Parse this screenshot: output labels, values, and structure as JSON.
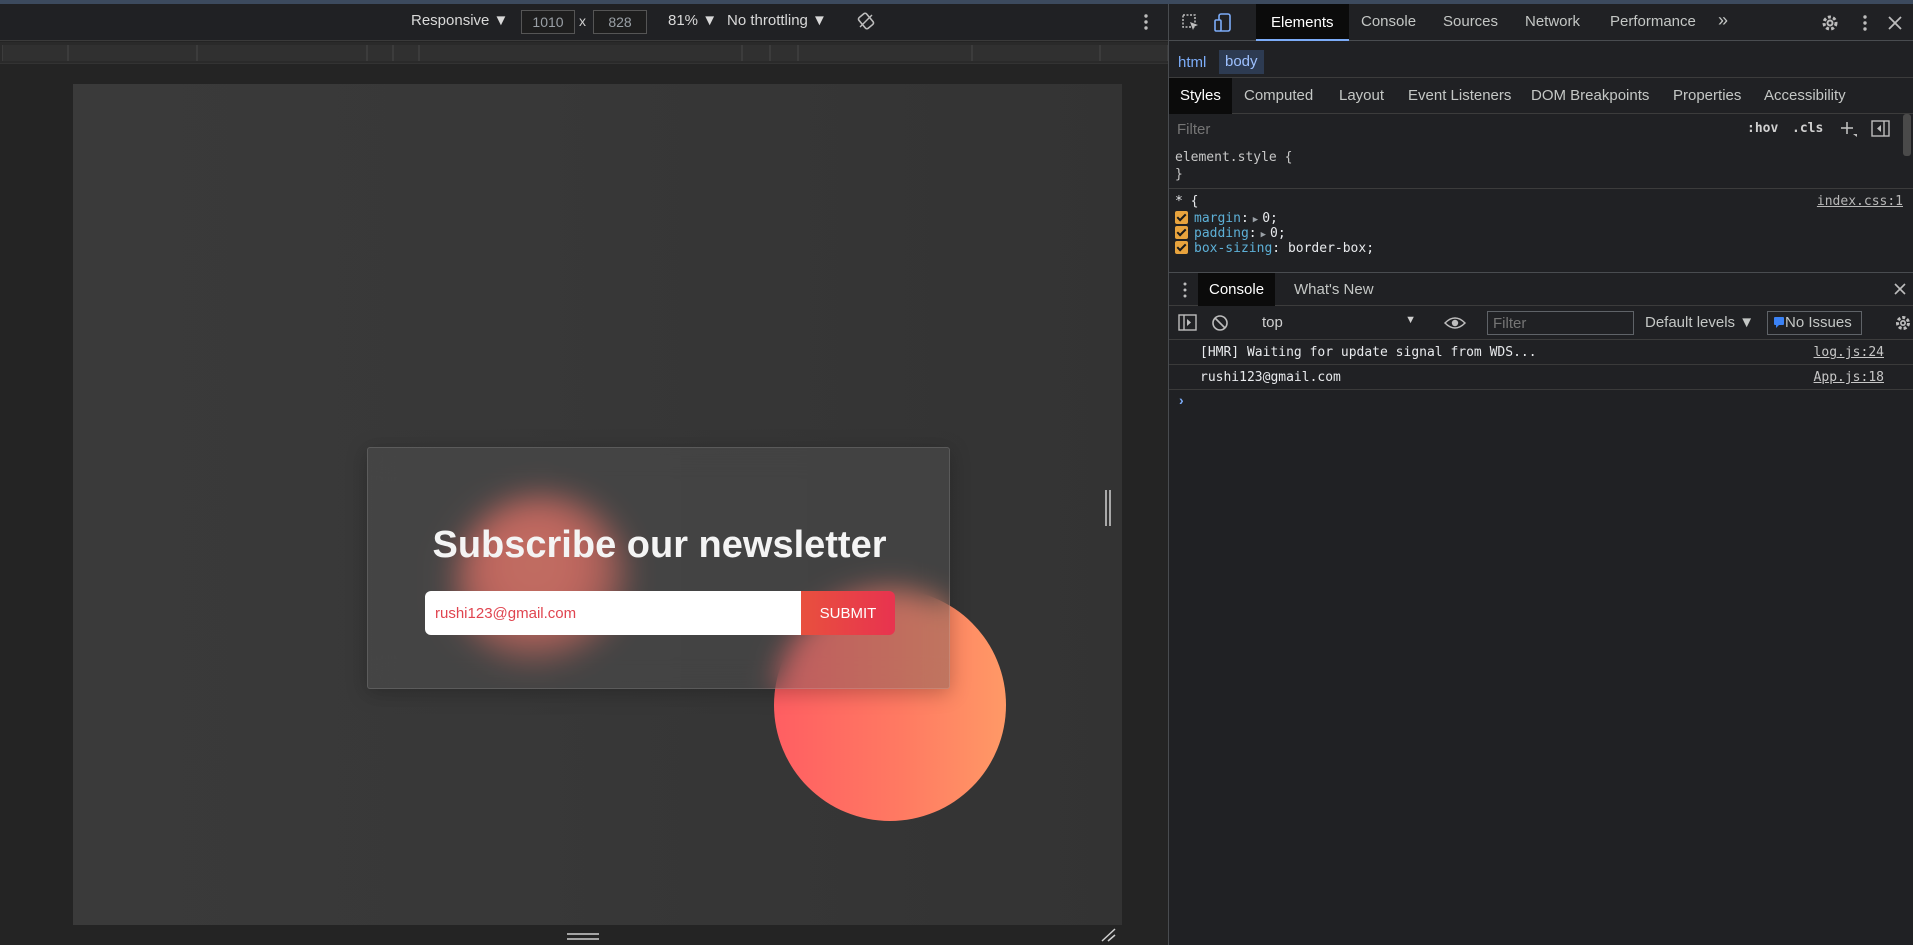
{
  "device_toolbar": {
    "device": "Responsive ▼",
    "width": "1010",
    "height": "828",
    "times": "x",
    "zoom": "81% ▼",
    "throttling": "No throttling ▼"
  },
  "page": {
    "title": "Subscribe our newsletter",
    "email_value": "rushi123@gmail.com",
    "submit_label": "SUBMIT"
  },
  "devtools": {
    "tabs": [
      "Elements",
      "Console",
      "Sources",
      "Network",
      "Performance"
    ],
    "more_tabs": "»",
    "breadcrumb": [
      "html",
      "body"
    ],
    "subtabs": [
      "Styles",
      "Computed",
      "Layout",
      "Event Listeners",
      "DOM Breakpoints",
      "Properties",
      "Accessibility"
    ],
    "filter_placeholder": "Filter",
    "hov": ":hov",
    "cls": ".cls",
    "styles": {
      "element_style_open": "element.style {",
      "close_brace": "}",
      "rule_selector": "* {",
      "rule_source": "index.css:1",
      "props": [
        {
          "name": "margin",
          "value": "0;"
        },
        {
          "name": "padding",
          "value": "0;"
        },
        {
          "name": "box-sizing",
          "value": "border-box;"
        }
      ]
    },
    "drawer_tabs": [
      "Console",
      "What's New"
    ],
    "console_toolbar": {
      "context": "top",
      "filter_placeholder": "Filter",
      "levels": "Default levels ▼",
      "issues": "No Issues"
    },
    "messages": [
      {
        "text": "[HMR] Waiting for update signal from WDS...",
        "source": "log.js:24"
      },
      {
        "text": "rushi123@gmail.com",
        "source": "App.js:18"
      }
    ],
    "prompt": "›"
  },
  "colors": {
    "accent": "#7cacf8",
    "checkbox": "#e8a33d",
    "submit_start": "#e8503e",
    "submit_end": "#e8334f",
    "circle_start": "#ff5e62",
    "circle_end": "#ff9966"
  }
}
